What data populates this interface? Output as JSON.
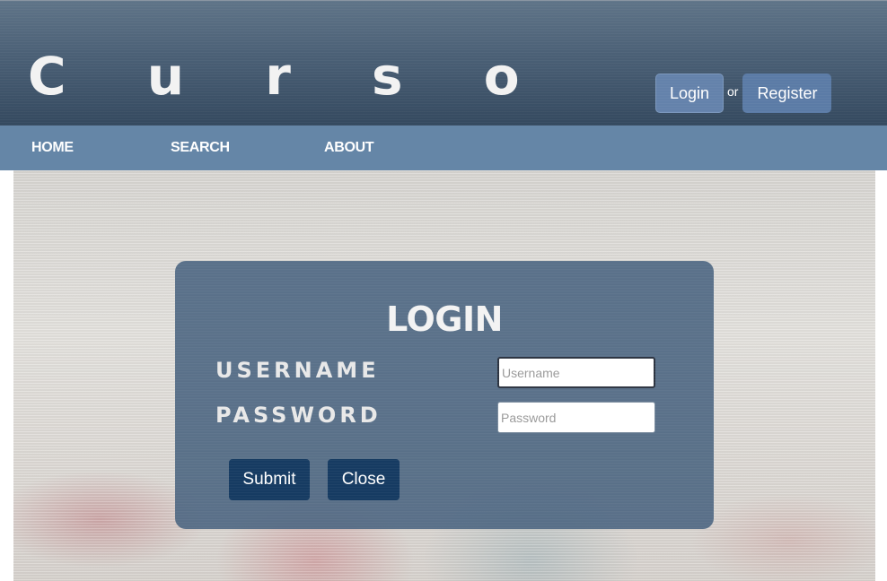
{
  "header": {
    "brand": "C u r s o",
    "login_label": "Login",
    "or_label": "or",
    "register_label": "Register"
  },
  "nav": {
    "items": [
      {
        "label": "HOME"
      },
      {
        "label": "SEARCH"
      },
      {
        "label": "ABOUT"
      }
    ]
  },
  "login_modal": {
    "title": "LOGIN",
    "username_label": "USERNAME",
    "username_placeholder": "Username",
    "username_value": "",
    "password_label": "PASSWORD",
    "password_placeholder": "Password",
    "password_value": "",
    "submit_label": "Submit",
    "close_label": "Close"
  },
  "colors": {
    "header_top": "#5f7488",
    "header_bottom": "#34495f",
    "nav_bar": "#6586a7",
    "auth_button": "#5b7ba6",
    "modal_background": "#48627e",
    "modal_button": "#163b62"
  }
}
